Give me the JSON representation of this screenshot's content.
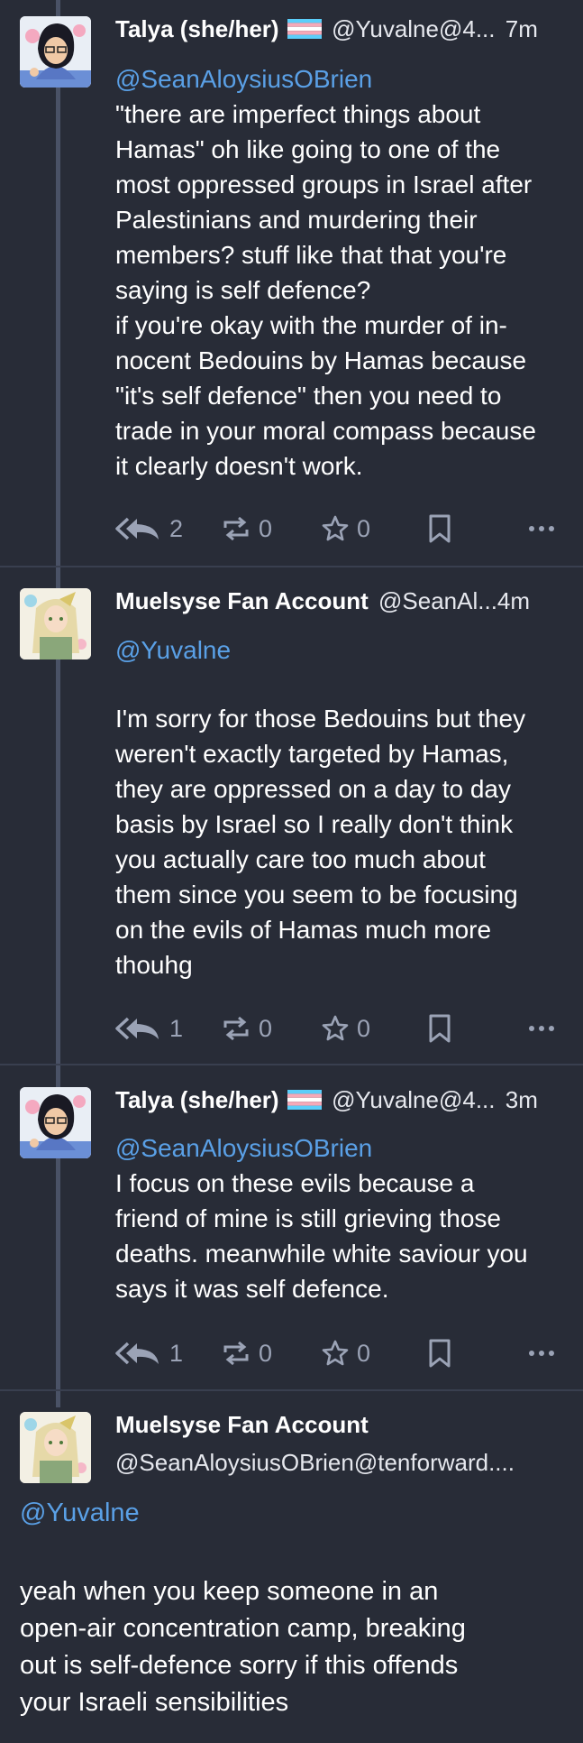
{
  "posts": [
    {
      "author_name": "Talya (she/her)",
      "author_acct": "@Yuvalne@4...",
      "time": "7m",
      "mention": "@SeanAloysiusOBrien",
      "text": "\"there are imperfect things about\nHamas\" oh like going to one of the\nmost oppressed groups in Israel after\nPalestinians and murdering their\nmembers? stuff like that that you're\nsaying is self defence?\nif you're okay with the murder of in-\nnocent Bedouins by Hamas because\n\"it's self defence\" then you need to\ntrade in your moral compass because\nit clearly doesn't work.",
      "replies": "2",
      "boosts": "0",
      "favourites": "0"
    },
    {
      "author_name": "Muelsyse Fan Account",
      "author_acct": "@SeanAl...",
      "time": "4m",
      "mention": "@Yuvalne",
      "text": "I'm sorry for those Bedouins but they\nweren't exactly targeted by Hamas,\nthey are oppressed on a day to day\nbasis by Israel so I really don't think\nyou actually care too much about\nthem since you seem to be focusing\non the evils of Hamas much more\nthouhg",
      "replies": "1",
      "boosts": "0",
      "favourites": "0"
    },
    {
      "author_name": "Talya (she/her)",
      "author_acct": "@Yuvalne@4...",
      "time": "3m",
      "mention": "@SeanAloysiusOBrien",
      "text": "I focus on these evils because a\nfriend of mine is still grieving those\ndeaths. meanwhile white saviour you\nsays it was self defence.",
      "replies": "1",
      "boosts": "0",
      "favourites": "0"
    },
    {
      "author_name": "Muelsyse Fan Account",
      "author_acct": "@SeanAloysiusOBrien@tenforward....",
      "mention": "@Yuvalne",
      "text": "yeah when you keep someone in an\nopen-air concentration camp, breaking\nout is self-defence sorry if this offends\nyour Israeli sensibilities"
    }
  ],
  "icons": {
    "reply": "reply-all-icon",
    "boost": "boost-icon",
    "favourite": "star-icon",
    "bookmark": "bookmark-icon",
    "more": "more-icon"
  },
  "colors": {
    "background": "#282c37",
    "mention": "#5aa0e6",
    "icon": "#9ba3b6",
    "thread_line": "#4a5266"
  }
}
